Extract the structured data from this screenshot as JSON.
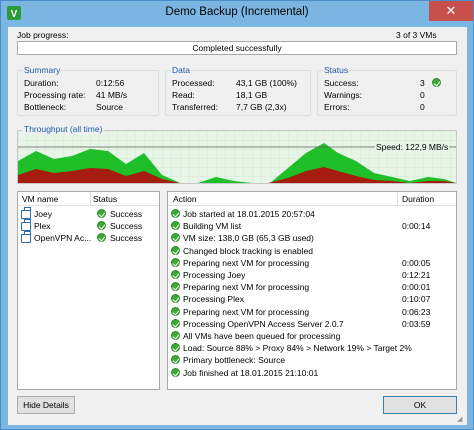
{
  "window": {
    "title": "Demo Backup (Incremental)",
    "close_glyph": "✕"
  },
  "job": {
    "progress_label": "Job progress:",
    "vm_count": "3 of 3 VMs",
    "status_text": "Completed successfully",
    "progress": 1.0
  },
  "summary": {
    "title": "Summary",
    "rows": [
      {
        "label": "Duration:",
        "value": "0:12:56"
      },
      {
        "label": "Processing rate:",
        "value": "41 MB/s"
      },
      {
        "label": "Bottleneck:",
        "value": "Source"
      }
    ]
  },
  "data": {
    "title": "Data",
    "rows": [
      {
        "label": "Processed:",
        "value": "43,1 GB (100%)"
      },
      {
        "label": "Read:",
        "value": "18,1 GB"
      },
      {
        "label": "Transferred:",
        "value": "7,7 GB (2,3x)"
      }
    ]
  },
  "status": {
    "title": "Status",
    "rows": [
      {
        "label": "Success:",
        "value": "3"
      },
      {
        "label": "Warnings:",
        "value": "0"
      },
      {
        "label": "Errors:",
        "value": "0"
      }
    ]
  },
  "throughput": {
    "title": "Throughput (all time)",
    "speed": "Speed: 122,9 MB/s"
  },
  "vms": {
    "headers": {
      "name": "VM name",
      "status": "Status"
    },
    "rows": [
      {
        "name": "Joey",
        "status": "Success"
      },
      {
        "name": "Plex",
        "status": "Success"
      },
      {
        "name": "OpenVPN Ac...",
        "status": "Success"
      }
    ]
  },
  "actions": {
    "headers": {
      "action": "Action",
      "duration": "Duration"
    },
    "rows": [
      {
        "action": "Job started at 18.01.2015 20:57:04",
        "duration": ""
      },
      {
        "action": "Building VM list",
        "duration": "0:00:14"
      },
      {
        "action": "VM size: 138,0 GB (65,3 GB used)",
        "duration": ""
      },
      {
        "action": "Changed block tracking is enabled",
        "duration": ""
      },
      {
        "action": "Preparing next VM for processing",
        "duration": "0:00:05"
      },
      {
        "action": "Processing Joey",
        "duration": "0:12:21"
      },
      {
        "action": "Preparing next VM for processing",
        "duration": "0:00:01"
      },
      {
        "action": "Processing Plex",
        "duration": "0:10:07"
      },
      {
        "action": "Preparing next VM for processing",
        "duration": "0:06:23"
      },
      {
        "action": "Processing OpenVPN Access Server 2.0.7",
        "duration": "0:03:59"
      },
      {
        "action": "All VMs have been queued for processing",
        "duration": ""
      },
      {
        "action": "Load: Source 88% > Proxy 84% > Network 19% > Target 2%",
        "duration": ""
      },
      {
        "action": "Primary bottleneck: Source",
        "duration": ""
      },
      {
        "action": "Job finished at 18.01.2015 21:10:01",
        "duration": ""
      }
    ]
  },
  "buttons": {
    "hide_details": "Hide Details",
    "ok": "OK"
  },
  "colors": {
    "success": "#3ea836",
    "green_area": "#1fbf2a",
    "red_area": "#a61c0e",
    "accent": "#1e5aa8"
  }
}
